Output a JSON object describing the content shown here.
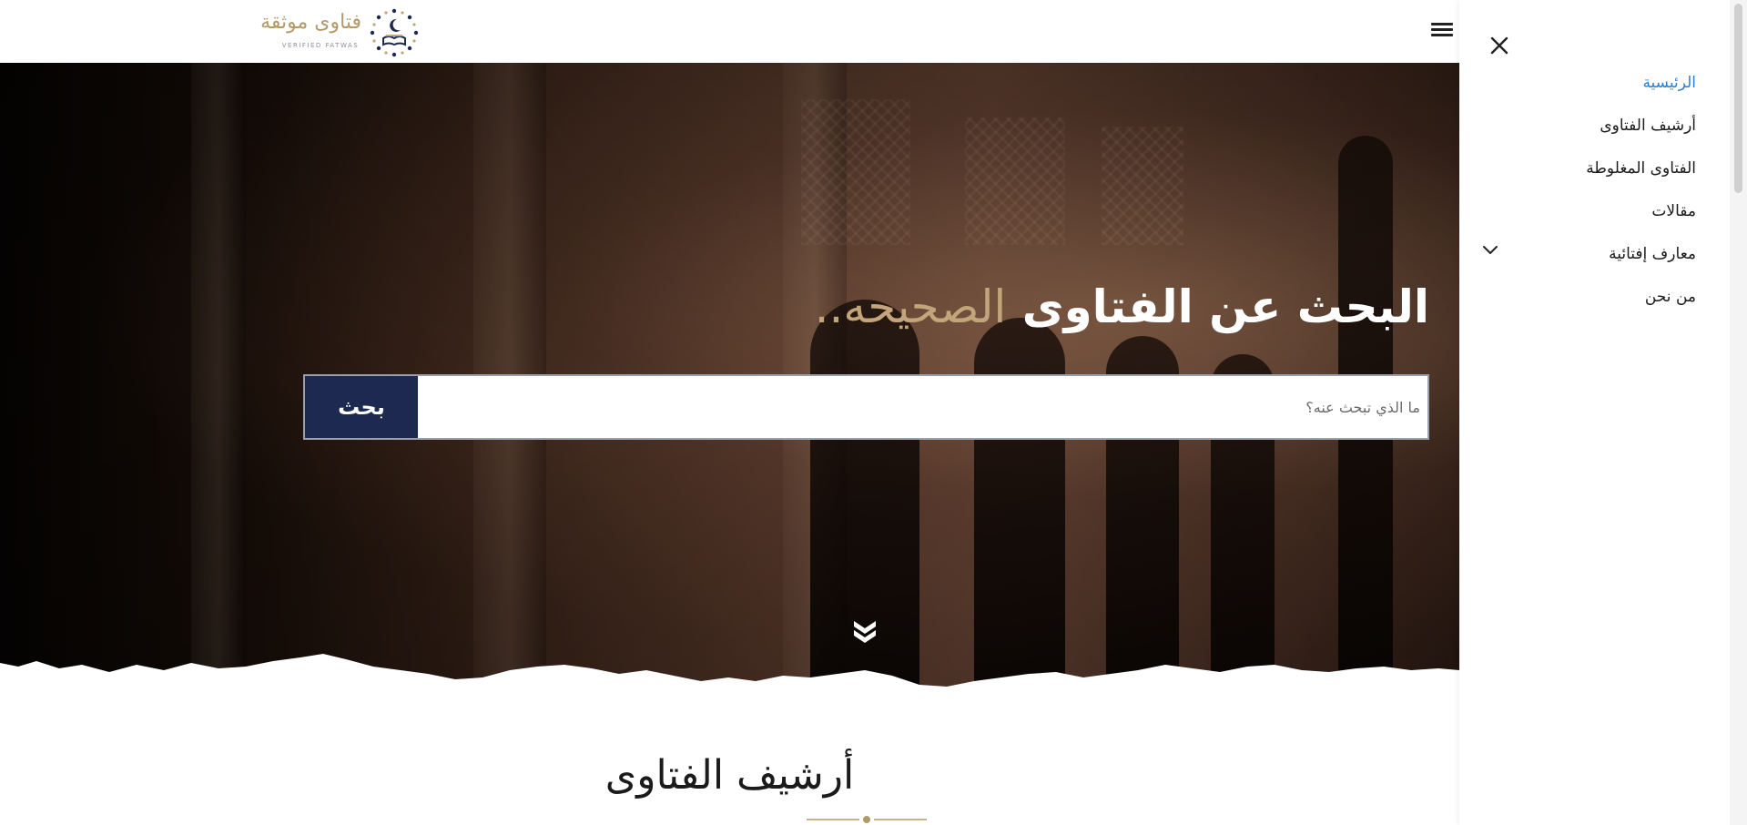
{
  "header": {
    "logo_text": "فتاوى موثقة",
    "logo_subtitle": "VERIFIED FATWAS",
    "menu_icon": "hamburger-menu-icon"
  },
  "hero": {
    "title_main": "البحث عن الفتاوى",
    "title_accent": "الصحيحه..",
    "search_placeholder": "ما الذي تبحث عنه؟",
    "search_value": "",
    "search_button": "بحث",
    "scroll_icon": "double-chevron-down-icon"
  },
  "section": {
    "title": "أرشيف الفتاوى"
  },
  "drawer": {
    "close_icon": "close-icon",
    "items": [
      {
        "label": "الرئيسية",
        "active": true
      },
      {
        "label": "أرشيف الفتاوى",
        "active": false
      },
      {
        "label": "الفتاوى المغلوطة",
        "active": false
      },
      {
        "label": "مقالات",
        "active": false
      },
      {
        "label": "معارف إفتائية",
        "active": false,
        "has_submenu": true
      },
      {
        "label": "من نحن",
        "active": false
      }
    ]
  },
  "colors": {
    "accent_gold": "#c2a57a",
    "button_navy": "#1d2951",
    "active_link": "#2b7fcf"
  }
}
